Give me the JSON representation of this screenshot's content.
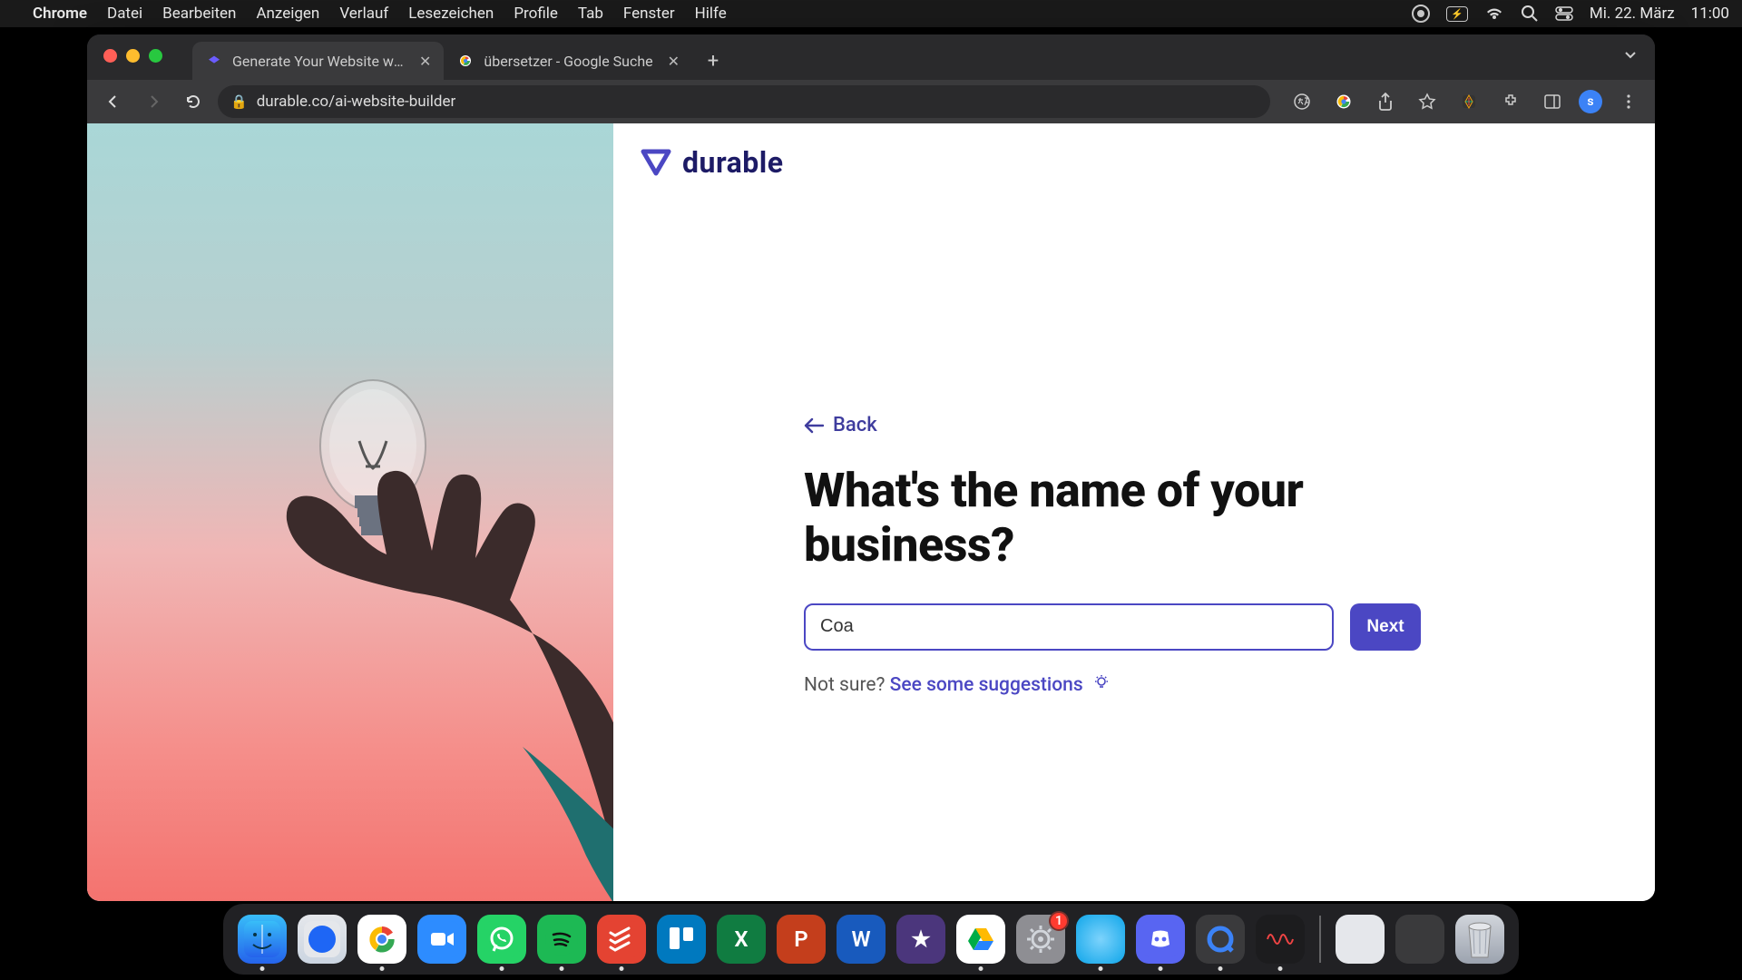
{
  "menubar": {
    "app": "Chrome",
    "items": [
      "Datei",
      "Bearbeiten",
      "Anzeigen",
      "Verlauf",
      "Lesezeichen",
      "Profile",
      "Tab",
      "Fenster",
      "Hilfe"
    ],
    "date": "Mi. 22. März",
    "time": "11:00"
  },
  "browser": {
    "tabs": [
      {
        "title": "Generate Your Website with AI",
        "active": true
      },
      {
        "title": "übersetzer - Google Suche",
        "active": false
      }
    ],
    "url": "durable.co/ai-website-builder",
    "avatar_letter": "s"
  },
  "page": {
    "brand": "durable",
    "back_label": "Back",
    "heading": "What's the name of your business?",
    "input_value": "Coa",
    "next_label": "Next",
    "not_sure_prefix": "Not sure? ",
    "suggestions_link": "See some suggestions"
  },
  "dock": {
    "apps": [
      {
        "name": "finder",
        "bg": "linear-gradient(180deg,#38bdf8,#2563eb)",
        "glyph": "",
        "running": true
      },
      {
        "name": "safari",
        "bg": "linear-gradient(180deg,#e5e7eb,#cbd5e1)",
        "glyph": "",
        "running": false
      },
      {
        "name": "chrome",
        "bg": "#fff",
        "glyph": "",
        "running": true
      },
      {
        "name": "zoom",
        "bg": "#2d8cff",
        "glyph": "",
        "running": false
      },
      {
        "name": "whatsapp",
        "bg": "#25d366",
        "glyph": "",
        "running": true
      },
      {
        "name": "spotify",
        "bg": "#1db954",
        "glyph": "",
        "running": true
      },
      {
        "name": "todoist",
        "bg": "#e44332",
        "glyph": "",
        "running": true
      },
      {
        "name": "trello",
        "bg": "#0079bf",
        "glyph": "",
        "running": false
      },
      {
        "name": "excel",
        "bg": "#107c41",
        "glyph": "X",
        "running": false
      },
      {
        "name": "powerpoint",
        "bg": "#c43e1c",
        "glyph": "P",
        "running": false
      },
      {
        "name": "word",
        "bg": "#185abd",
        "glyph": "W",
        "running": false
      },
      {
        "name": "imovie",
        "bg": "#4b367c",
        "glyph": "★",
        "running": false
      },
      {
        "name": "drive",
        "bg": "#fff",
        "glyph": "",
        "running": true
      },
      {
        "name": "settings",
        "bg": "#8e8e93",
        "glyph": "",
        "running": false,
        "badge": "1"
      },
      {
        "name": "app-blue",
        "bg": "radial-gradient(circle,#7dd3fc,#0ea5e9)",
        "glyph": "",
        "running": true
      },
      {
        "name": "discord",
        "bg": "#5865f2",
        "glyph": "",
        "running": true
      },
      {
        "name": "quicktime",
        "bg": "#3a3a3c",
        "glyph": "",
        "running": true
      },
      {
        "name": "voice-memos",
        "bg": "#1c1c1e",
        "glyph": "",
        "running": true
      }
    ],
    "right_apps": [
      {
        "name": "app-util",
        "bg": "#e5e7eb",
        "glyph": ""
      },
      {
        "name": "screenshot",
        "bg": "#3a3a3c",
        "glyph": ""
      },
      {
        "name": "trash",
        "bg": "linear-gradient(180deg,#d1d5db,#9ca3af)",
        "glyph": ""
      }
    ]
  }
}
